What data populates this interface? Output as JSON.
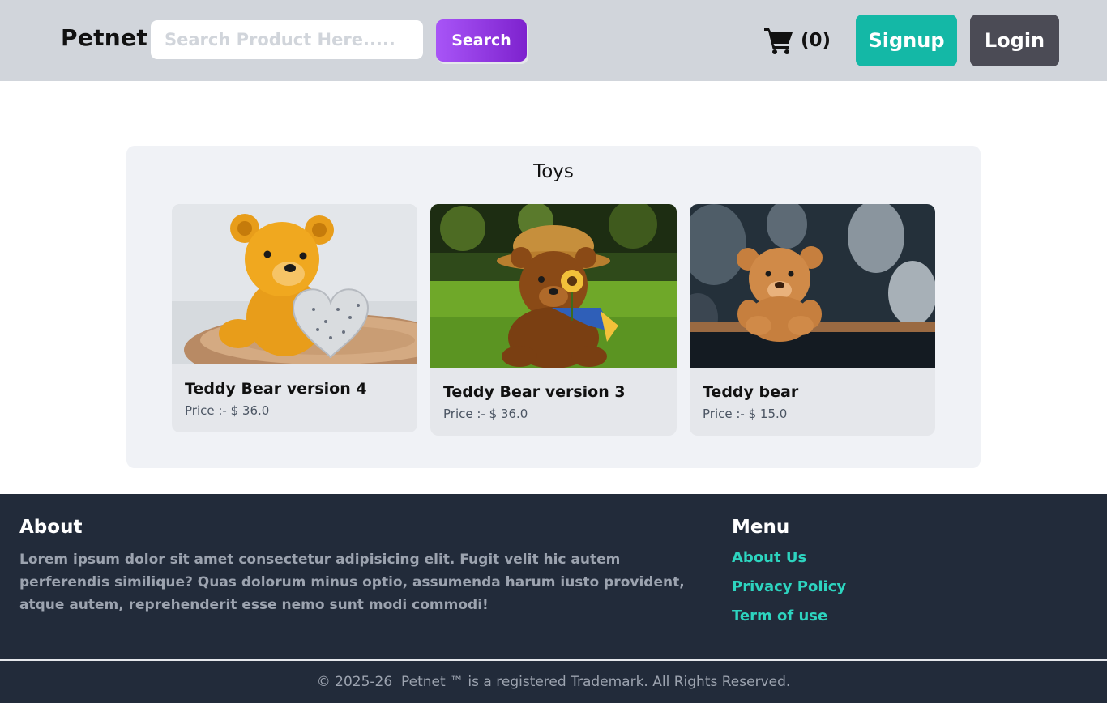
{
  "header": {
    "brand": "Petnet",
    "search": {
      "placeholder": "Search Product Here.....",
      "value": ""
    },
    "search_button": "Search",
    "cart": {
      "icon": "shopping-cart-icon",
      "count_label": "(0)"
    },
    "signup_button": "Signup",
    "login_button": "Login"
  },
  "section": {
    "title": "Toys",
    "products": [
      {
        "name": "Teddy Bear version 4",
        "price_label": "Price :- $ 36.0",
        "image": "yellow teddy bear beside a silver heart on a wood slice"
      },
      {
        "name": "Teddy Bear version 3",
        "price_label": "Price :- $ 36.0",
        "image": "brown teddy bear in straw hat with sunflower on grass"
      },
      {
        "name": "Teddy bear",
        "price_label": "Price :- $ 15.0",
        "image": "light brown teddy bear sitting on a wooden shelf"
      }
    ]
  },
  "footer": {
    "about": {
      "heading": "About",
      "text": "Lorem ipsum dolor sit amet consectetur adipisicing elit. Fugit velit hic autem perferendis similique? Quas dolorum minus optio, assumenda harum iusto provident, atque autem, reprehenderit esse nemo sunt modi commodi!"
    },
    "menu": {
      "heading": "Menu",
      "links": [
        "About Us",
        "Privacy Policy",
        "Term of use"
      ]
    },
    "copyright": "© 2025-26  Petnet ™ is a registered Trademark. All Rights Reserved."
  },
  "colors": {
    "header_bg": "#d1d5db",
    "search_gradient_start": "#a855f7",
    "search_gradient_end": "#7e22ce",
    "signup_bg": "#14b8a6",
    "login_bg": "#4b4b55",
    "section_bg": "#f0f2f6",
    "card_bg": "#e5e7eb",
    "footer_bg": "#222b3a",
    "footer_link": "#2dd4bf"
  }
}
